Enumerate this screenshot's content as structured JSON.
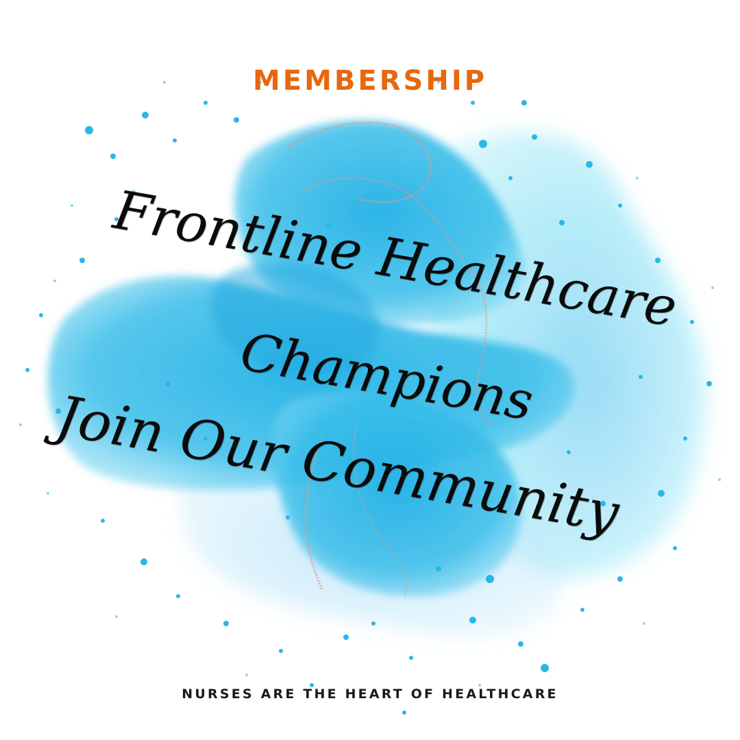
{
  "eyebrow": "MEMBERSHIP",
  "headline": {
    "line1": "Frontline Healthcare",
    "line2": "Champions",
    "line3": "Join Our Community"
  },
  "tagline": "NURSES ARE THE HEART OF HEALTHCARE",
  "colors": {
    "eyebrow": "#E8670F",
    "headline": "#0b0b0b",
    "tagline": "#1a1a1a",
    "ink_main": "#2bb6e6",
    "ink_light": "#7ddcf5",
    "ink_pale": "#bfeffb",
    "glitter": "#d89a8e"
  },
  "decor": {
    "background": "alcohol-ink-blue-watercolor",
    "accent": "rose-gold-glitter-veins",
    "speckles": "blue-ink-droplets"
  }
}
